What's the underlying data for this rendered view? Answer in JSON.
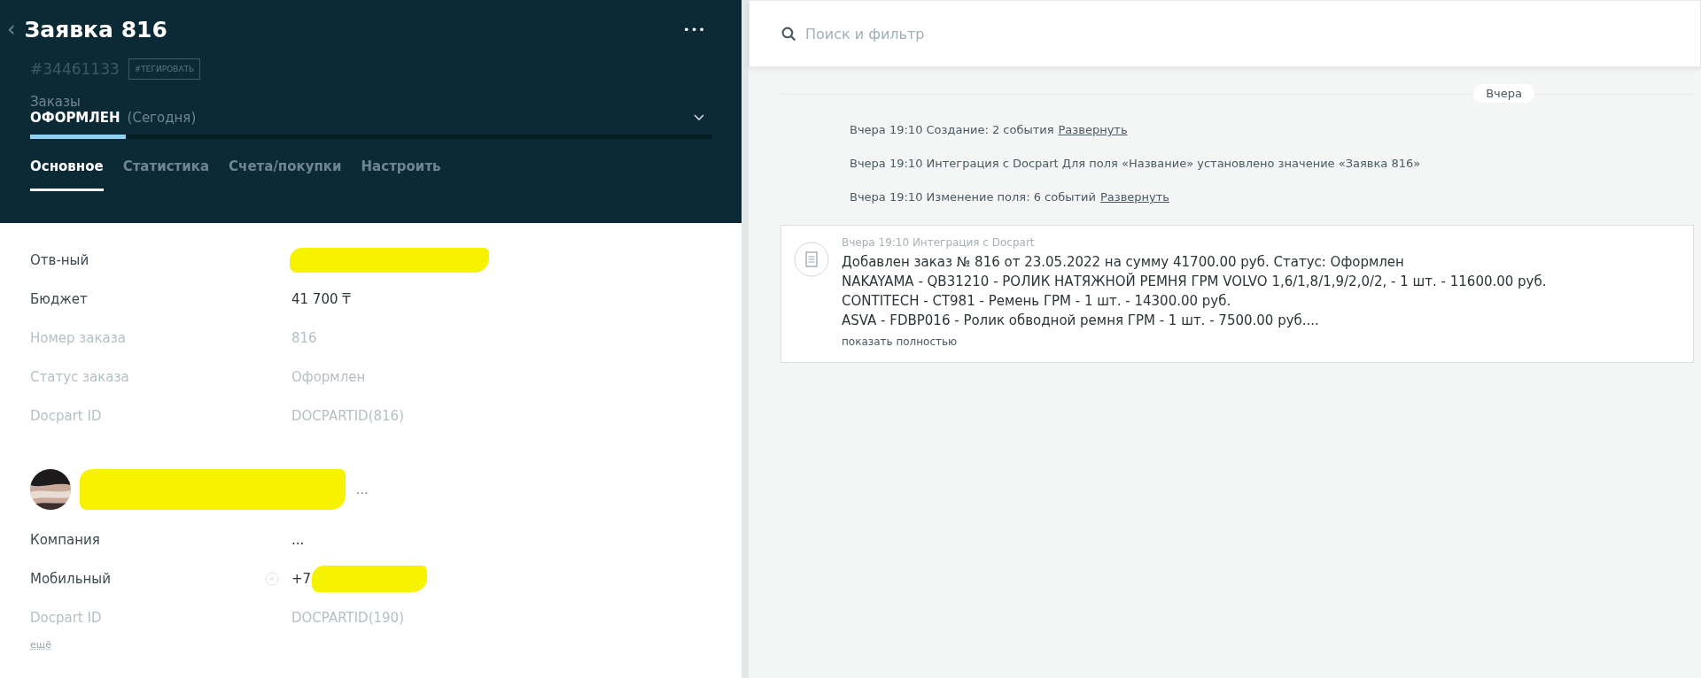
{
  "header": {
    "back_icon": "‹",
    "title": "Заявка 816",
    "menu": "•••",
    "id": "#34461133",
    "tag_button": "#ТЕГИРОВАТЬ",
    "pipeline": "Заказы",
    "status": "ОФОРМЛЕН",
    "status_date": "(Сегодня)",
    "level": 0.14
  },
  "tabs": [
    {
      "label": "Основное",
      "selected": true
    },
    {
      "label": "Статистика",
      "selected": false
    },
    {
      "label": "Счета/покупки",
      "selected": false
    },
    {
      "label": "Настроить",
      "selected": false
    }
  ],
  "fields": [
    {
      "label": "Отв-ный",
      "redacted": true,
      "muted": false
    },
    {
      "label": "Бюджет",
      "value": "41 700 ₸",
      "muted": false
    },
    {
      "label": "Номер заказа",
      "value": "816",
      "muted": true
    },
    {
      "label": "Статус заказа",
      "value": "Оформлен",
      "muted": true
    },
    {
      "label": "Docpart ID",
      "value": "DOCPARTID(816)",
      "muted": true
    }
  ],
  "contact": {
    "name_redacted": true,
    "menu": "...",
    "fields": [
      {
        "label": "Компания",
        "value": "...",
        "muted": false,
        "kind": "plain"
      },
      {
        "label": "Мобильный",
        "value": "+7",
        "redacted": true,
        "muted": false,
        "kind": "phone"
      },
      {
        "label": "Docpart ID",
        "value": "DOCPARTID(190)",
        "muted": true,
        "kind": "plain"
      }
    ],
    "more_link": "ещё"
  },
  "search": {
    "placeholder": "Поиск и фильтр"
  },
  "feed": {
    "date": "Вчера",
    "events": [
      {
        "text": "Вчера 19:10 Создание: 2 события",
        "link": "Развернуть"
      },
      {
        "text": "Вчера 19:10 Интеграция с Docpart Для поля «Название» установлено значение «Заявка 816»"
      },
      {
        "text": "Вчера 19:10 Изменение поля: 6 событий",
        "link": "Развернуть"
      }
    ],
    "note": {
      "meta": "Вчера 19:10 Интеграция с Docpart",
      "lines": [
        "Добавлен заказ № 816 от 23.05.2022 на сумму 41700.00 руб. Статус: Оформлен",
        "NAKAYAMA - QB31210 - РОЛИК НАТЯЖНОЙ РЕМНЯ ГРМ VOLVO 1,6/1,8/1,9/2,0/2, - 1 шт. - 11600.00 руб.",
        "CONTITECH - CT981 - Ремень ГРМ - 1 шт. - 14300.00 руб.",
        "ASVA - FDBP016 - Ролик обводной ремня ГРМ - 1 шт. - 7500.00 руб...."
      ],
      "show_more": "показать полностью"
    }
  }
}
